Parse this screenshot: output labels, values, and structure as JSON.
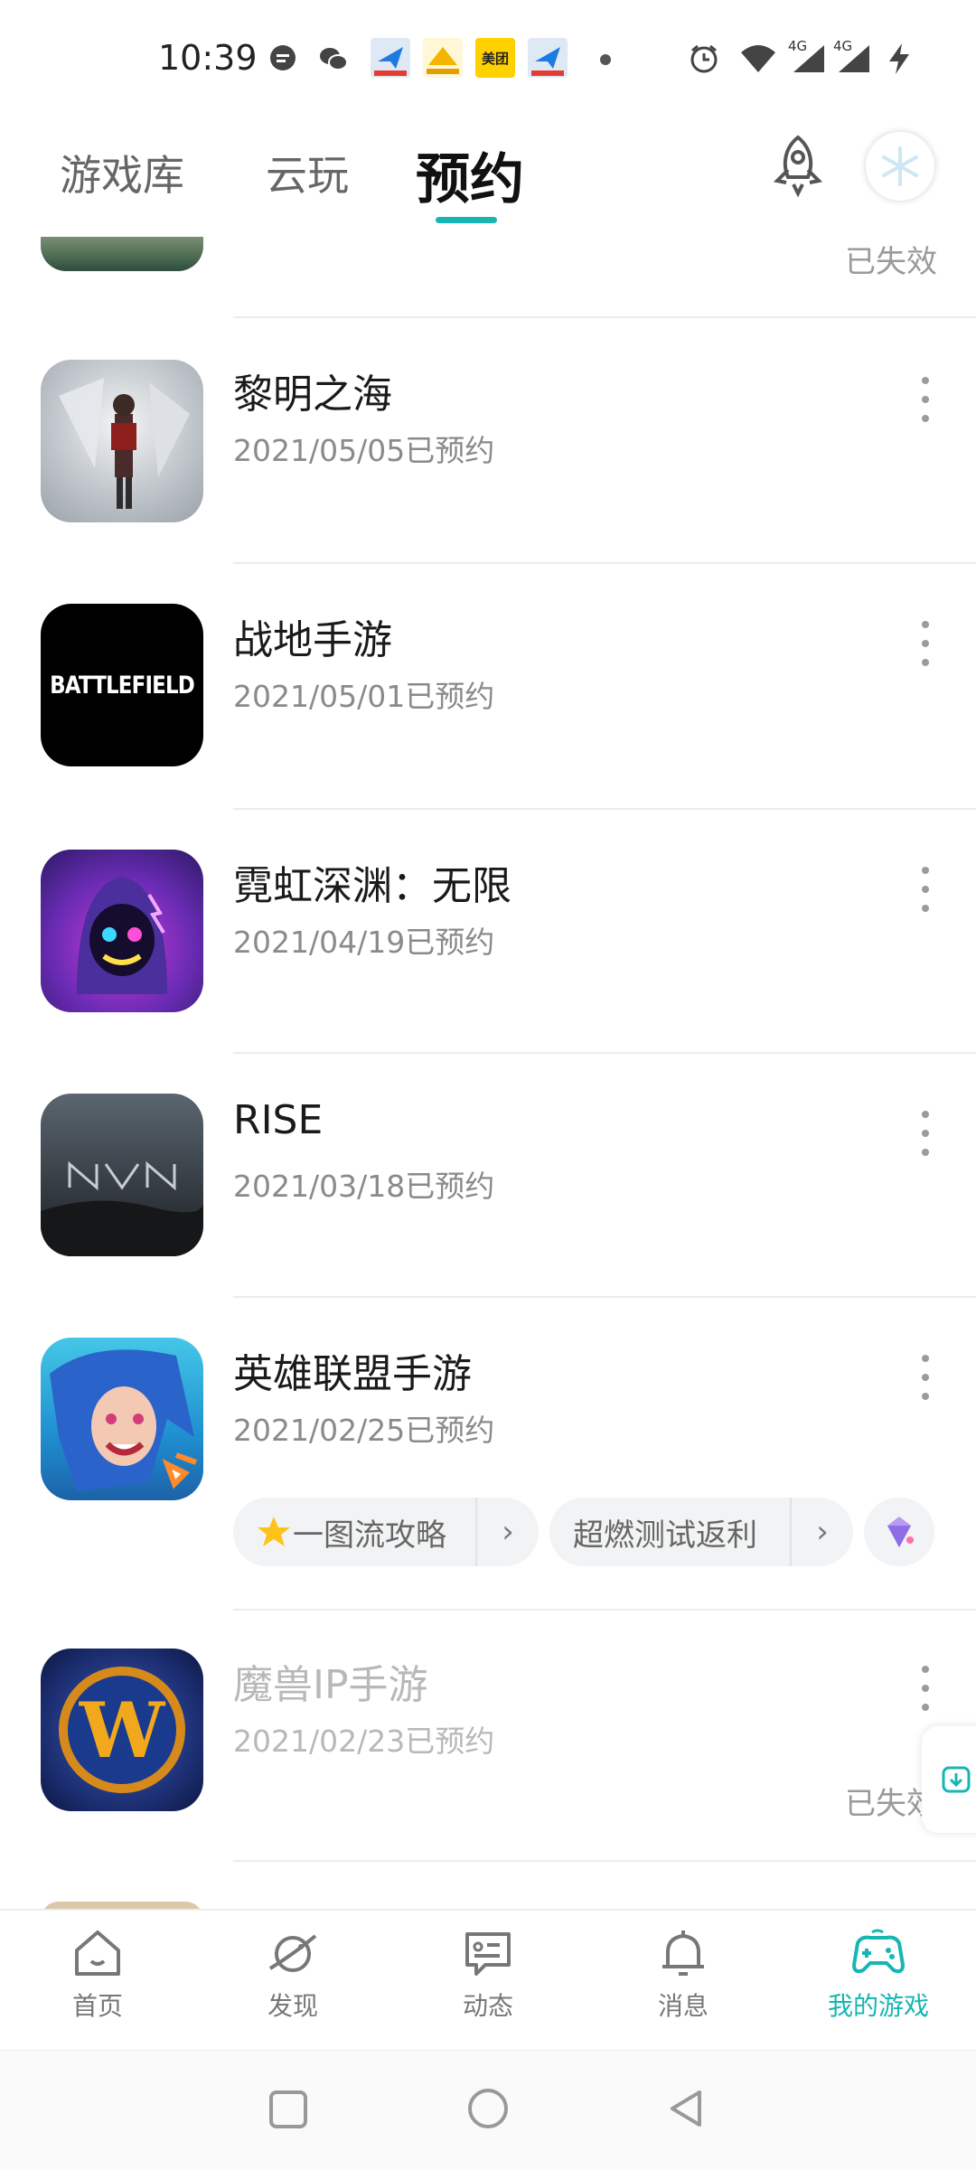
{
  "status_bar": {
    "time": "10:39",
    "icons": [
      "message-icon",
      "wechat-icon",
      "app-notification-icon",
      "app-notification-icon",
      "meituan-icon",
      "app-notification-icon",
      "alarm-icon",
      "wifi-icon",
      "signal-4g-icon",
      "signal-4g-icon",
      "charging-icon"
    ],
    "meituan_label": "美团",
    "network_label": "4G"
  },
  "top_nav": {
    "tabs": [
      {
        "label": "游戏库"
      },
      {
        "label": "云玩"
      },
      {
        "label": "预约"
      }
    ],
    "active_tab": "预约",
    "accent": "#17b6b3"
  },
  "list": {
    "expired_label": "已失效",
    "items": [
      {
        "title": "黎明之海",
        "date": "2021/05/05已预约"
      },
      {
        "title": "战地手游",
        "date": "2021/05/01已预约",
        "logo_text": "BATTLEFIELD"
      },
      {
        "title": "霓虹深渊：无限",
        "date": "2021/04/19已预约"
      },
      {
        "title": "RISE",
        "date": "2021/03/18已预约"
      },
      {
        "title": "英雄联盟手游",
        "date": "2021/02/25已预约",
        "chips": [
          {
            "label": "一图流攻略",
            "icon": "star-icon"
          },
          {
            "label": "超燃测试返利"
          },
          {
            "icon": "gift-icon"
          }
        ]
      },
      {
        "title": "魔兽IP手游",
        "date": "2021/02/23已预约",
        "status": "已失效",
        "logo_text": "W"
      }
    ]
  },
  "bottom_nav": {
    "items": [
      {
        "label": "首页",
        "icon": "home-icon"
      },
      {
        "label": "发现",
        "icon": "discover-icon"
      },
      {
        "label": "动态",
        "icon": "feed-icon"
      },
      {
        "label": "消息",
        "icon": "bell-icon"
      },
      {
        "label": "我的游戏",
        "icon": "gamepad-icon"
      }
    ],
    "active": "我的游戏"
  },
  "system_nav": [
    "recent-apps-button",
    "home-button",
    "back-button"
  ]
}
